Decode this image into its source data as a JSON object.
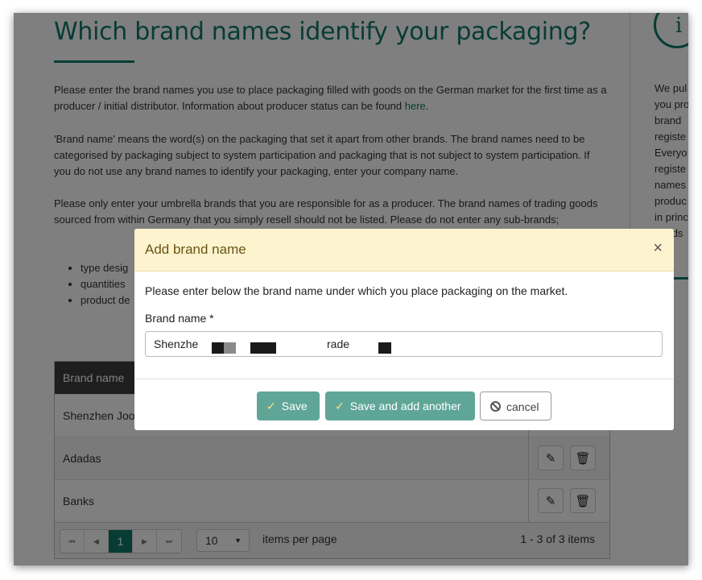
{
  "page": {
    "title": "Which brand names identify your packaging?",
    "para1_text": "Please enter the brand names you use to place packaging filled with goods on the German market for the first time as a producer / initial distributor. Information about producer status can be found ",
    "para1_link": "here",
    "para1_end": ".",
    "para2": "'Brand name' means the word(s) on the packaging that set it apart from other brands. The brand names need to be categorised by packaging subject to system participation and packaging that is not subject to system participation. If you do not use any brand names to identify your packaging, enter your company name.",
    "para3": "Please only enter your umbrella brands that you are responsible for as a producer. The brand names of trading goods sourced from within Germany that you simply resell should not be listed. Please do not enter any sub-brands;",
    "bullets": [
      "type desig",
      "quantities",
      "product de"
    ]
  },
  "sidebar": {
    "icon": "info-icon",
    "icon_glyph": "i",
    "lines": [
      "We pul",
      "you pro",
      "brand",
      "registe",
      "Everyo",
      "registe",
      "names",
      "produc",
      "in princ",
      "goods"
    ]
  },
  "grid": {
    "header": "Brand name",
    "rows": [
      "Shenzhen Joor",
      "Adadas",
      "Banks"
    ],
    "edit_glyph": "✎",
    "delete_glyph": "🗑",
    "pager": {
      "first": "⏮",
      "prev": "◀",
      "current": "1",
      "next": "▶",
      "last": "⏭",
      "page_size": "10",
      "page_size_arrow": "▼",
      "items_per_page": "items per page",
      "info": "1 - 3 of 3 items"
    }
  },
  "modal": {
    "title": "Add brand name",
    "close": "×",
    "description": "Please enter below the brand name under which you place packaging on the market.",
    "field_label": "Brand name *",
    "field_value_start": "Shenzhen",
    "field_value_mid": "rade",
    "save_label": "Save",
    "save_another_label": "Save and add another",
    "cancel_label": "cancel",
    "check_glyph": "✓",
    "accent_color": "#5fa698",
    "header_color": "#fdf4cf"
  }
}
